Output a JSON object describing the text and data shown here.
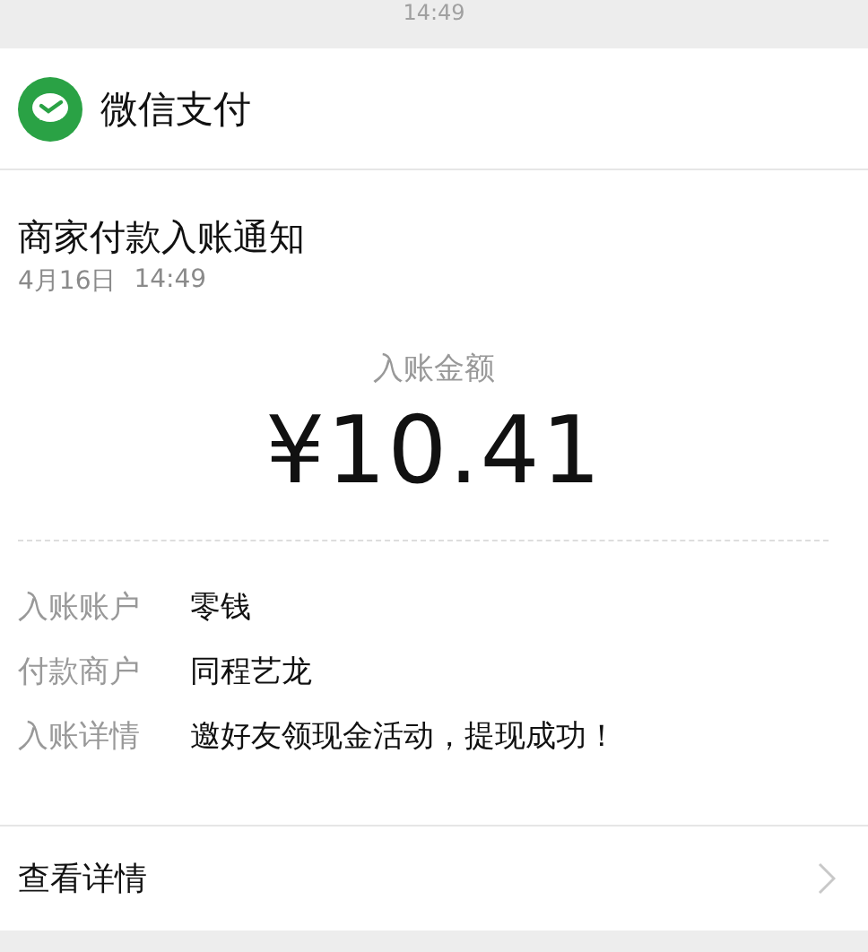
{
  "time": "14:49",
  "app": {
    "name": "微信支付"
  },
  "notice": {
    "title": "商家付款入账通知",
    "date": "4月16日",
    "time": "14:49"
  },
  "amount": {
    "label": "入账金额",
    "value": "¥10.41"
  },
  "details": [
    {
      "label": "入账账户",
      "value": "零钱"
    },
    {
      "label": "付款商户",
      "value": "同程艺龙"
    },
    {
      "label": "入账详情",
      "value": "邀好友领现金活动，提现成功！"
    }
  ],
  "link": {
    "label": "查看详情"
  }
}
